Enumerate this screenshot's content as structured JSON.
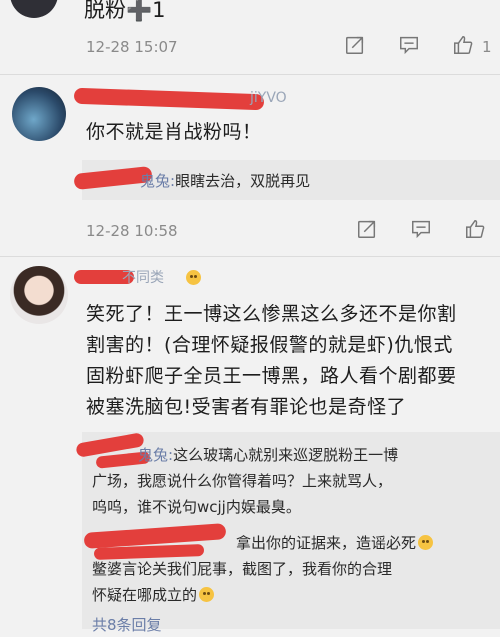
{
  "top_snippet": {
    "text": "脱粉➕1"
  },
  "comment1_meta": {
    "time": "12-28 15:07",
    "like_count": "1"
  },
  "comment2": {
    "username_tail": "jiYVO",
    "text": "你不就是肖战粉吗！",
    "reply": {
      "name": "鬼兔:",
      "text": "眼瞎去治，双脱再见"
    },
    "time": "12-28 10:58"
  },
  "comment3": {
    "username": "不同类",
    "lines": [
      "笑死了！王一博这么惨黑这么多还不是你割",
      "割害的！(合理怀疑报假警的就是虾)仇恨式",
      "固粉虾爬子全员王一博黑，路人看个剧都要",
      "被塞洗脑包!受害者有罪论也是奇怪了"
    ],
    "reply1": {
      "name": "鬼兔:",
      "line1": "这么玻璃心就别来巡逻脱粉王一博",
      "line2": "广场，我愿说什么你管得着吗？上来就骂人，",
      "line3": "呜呜，谁不说句wcjj内娱最臭。"
    },
    "reply2": {
      "line1": "拿出你的证据来，造谣必死",
      "line2": "鳖婆言论关我们屁事，截图了，我看你的合理",
      "line3": "怀疑在哪成立的"
    },
    "more_replies": "共8条回复"
  },
  "icons": [
    "share-icon",
    "comment-icon",
    "like-icon"
  ],
  "colors": {
    "background": "#f2f2f2",
    "redaction": "#e2322e",
    "username": "#9aa6b8"
  }
}
